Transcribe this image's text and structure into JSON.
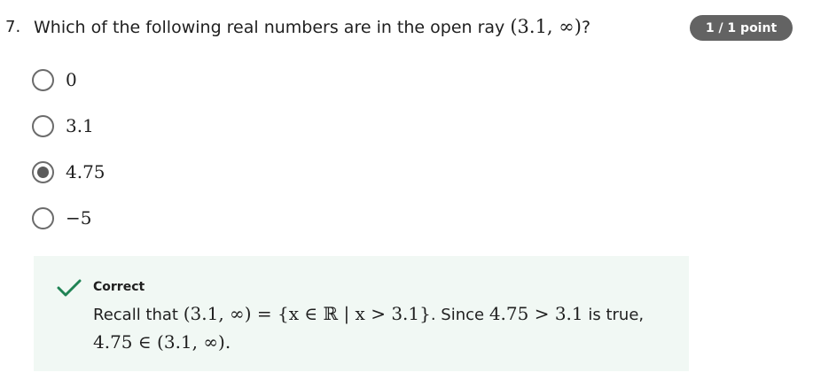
{
  "question": {
    "number": "7.",
    "text_before": "Which of the following real numbers are in the open ray ",
    "math": "(3.1, ∞)",
    "text_after": "?"
  },
  "points_badge": "1 / 1 point",
  "options": [
    {
      "label": "0",
      "selected": false
    },
    {
      "label": "3.1",
      "selected": false
    },
    {
      "label": "4.75",
      "selected": true
    },
    {
      "label": "−5",
      "selected": false
    }
  ],
  "feedback": {
    "status": "Correct",
    "recall": "Recall that ",
    "set_identity": "(3.1, ∞) = {x ∈ ℝ | x > 3.1}",
    "since": ". Since ",
    "inequality": "4.75 > 3.1",
    "is_true": " is true,",
    "membership": "4.75 ∈ (3.1, ∞)",
    "end": ".",
    "color": "#1f8354"
  }
}
